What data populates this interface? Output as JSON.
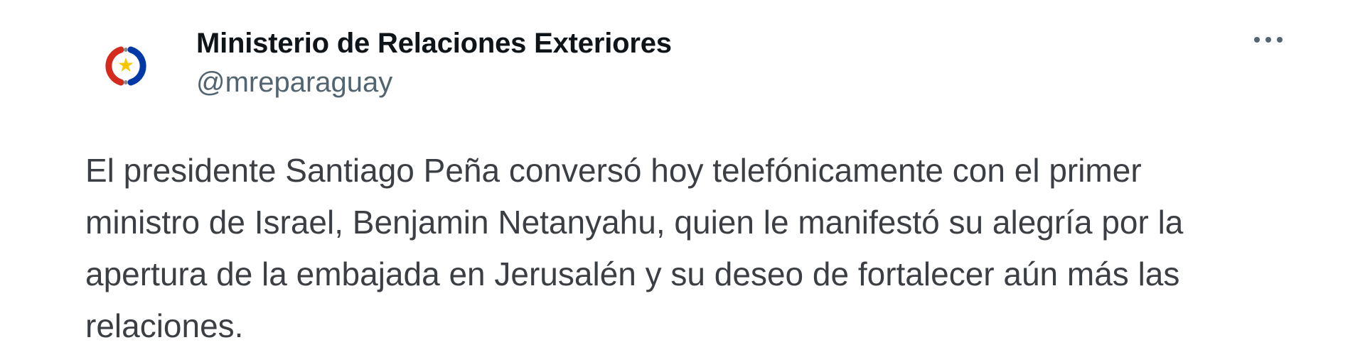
{
  "tweet": {
    "author": {
      "display_name": "Ministerio de Relaciones Exteriores",
      "handle": "@mreparaguay",
      "avatar_icon": "paraguay-seal-icon"
    },
    "more_icon": "more-options-icon",
    "text": "El presidente Santiago Peña conversó hoy telefónicamente con el primer\nministro de Israel, Benjamin Netanyahu, quien le manifestó su alegría por la\napertura de la embajada en Jerusalén y su deseo de fortalecer aún más las\nrelaciones."
  },
  "colors": {
    "name": "#0f1419",
    "handle": "#536471",
    "body": "#3b3f44",
    "seal_red": "#d52b1e",
    "seal_blue": "#0038a8",
    "seal_star": "#f7c600",
    "more_dots": "#536471"
  }
}
